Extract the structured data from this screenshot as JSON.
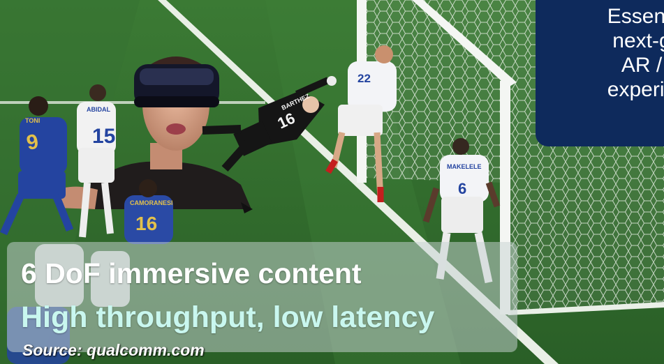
{
  "photo": {
    "description_icons": [
      "vr-headset-icon",
      "goalkeeper-figure",
      "soccer-goal-net"
    ],
    "players": [
      {
        "number": "9",
        "name_on_shirt": "TONI",
        "kit": "blue"
      },
      {
        "number": "15",
        "name_on_shirt": "ABIDAL",
        "kit": "white"
      },
      {
        "number": "16",
        "name_on_shirt": "BARTHEZ",
        "kit": "black"
      },
      {
        "number": "22",
        "name_on_shirt": "",
        "kit": "white"
      },
      {
        "number": "6",
        "name_on_shirt": "MAKELELE",
        "kit": "white"
      },
      {
        "number": "16",
        "name_on_shirt": "CAMORANESI",
        "kit": "blue"
      }
    ]
  },
  "callout": {
    "text": "Essenti\nnext-g\nAR / \nexperie"
  },
  "caption": {
    "headline": "6 DoF immersive content",
    "subline": "High throughput, low latency",
    "source": "Source: qualcomm.com"
  },
  "colors": {
    "pitch": "#2f6a2c",
    "callout_bg": "#0e2a5c",
    "subline": "#c9f7ef"
  }
}
